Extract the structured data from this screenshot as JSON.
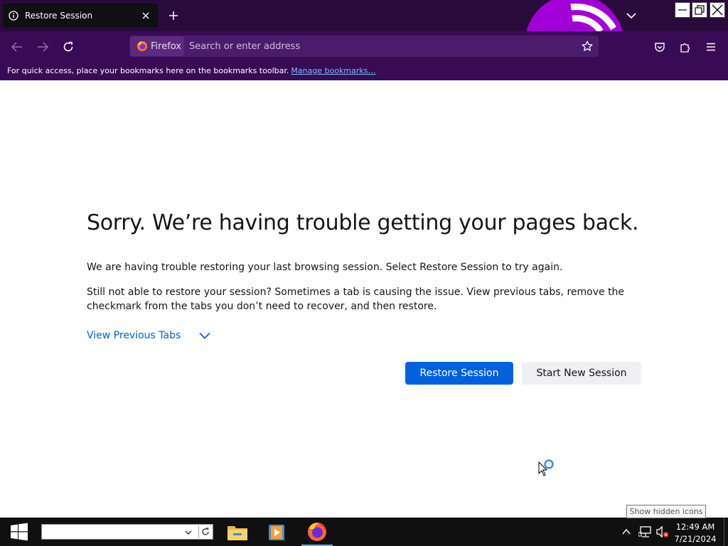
{
  "tab": {
    "title": "Restore Session"
  },
  "urlbar": {
    "identity_label": "Firefox",
    "placeholder": "Search or enter address"
  },
  "bookmarks_bar": {
    "message": "For quick access, place your bookmarks here on the bookmarks toolbar.",
    "link": "Manage bookmarks…"
  },
  "page": {
    "heading": "Sorry. We’re having trouble getting your pages back.",
    "para1": "We are having trouble restoring your last browsing session. Select Restore Session to try again.",
    "para2": "Still not able to restore your session? Sometimes a tab is causing the issue. View previous tabs, remove the checkmark from the tabs you don’t need to recover, and then restore.",
    "view_previous": "View Previous Tabs",
    "restore_button": "Restore Session",
    "start_new_button": "Start New Session"
  },
  "taskbar": {
    "tooltip": "Show hidden icons",
    "time": "12:49 AM",
    "date": "7/21/2024"
  },
  "colors": {
    "accent": "#0061e0",
    "toolbar": "#3a0b55",
    "tabstrip": "#2a0a3a"
  }
}
